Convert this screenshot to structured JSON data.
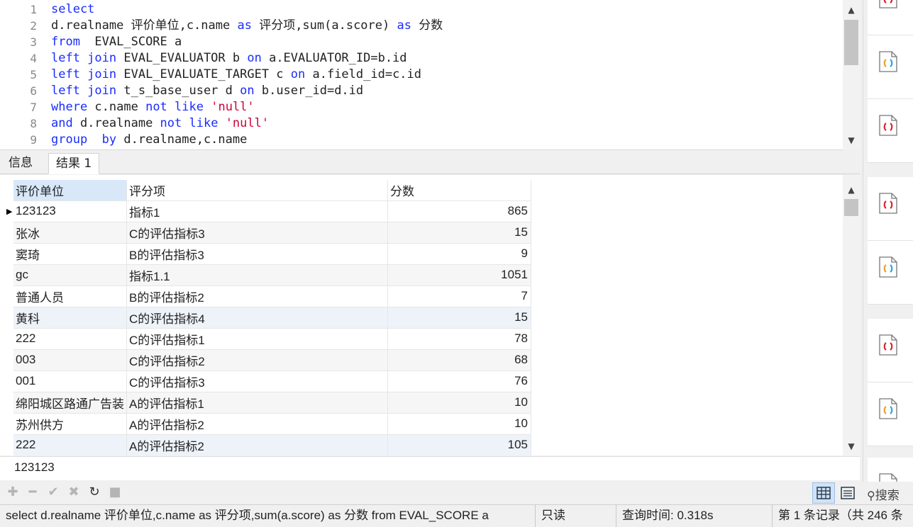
{
  "editor": {
    "lines": [
      {
        "num": "1",
        "tokens": [
          {
            "t": "select",
            "c": "kw"
          }
        ]
      },
      {
        "num": "2",
        "tokens": [
          {
            "t": "d.realname 评价单位,c.name ",
            "c": "id"
          },
          {
            "t": "as",
            "c": "kw"
          },
          {
            "t": " 评分项,sum(a.score) ",
            "c": "id"
          },
          {
            "t": "as",
            "c": "kw"
          },
          {
            "t": " 分数",
            "c": "id"
          }
        ]
      },
      {
        "num": "3",
        "tokens": [
          {
            "t": "from",
            "c": "kw"
          },
          {
            "t": "  EVAL_SCORE a",
            "c": "id"
          }
        ]
      },
      {
        "num": "4",
        "tokens": [
          {
            "t": "left join",
            "c": "kw"
          },
          {
            "t": " EVAL_EVALUATOR b ",
            "c": "id"
          },
          {
            "t": "on",
            "c": "kw"
          },
          {
            "t": " a.EVALUATOR_ID=b.id",
            "c": "id"
          }
        ]
      },
      {
        "num": "5",
        "tokens": [
          {
            "t": "left join",
            "c": "kw"
          },
          {
            "t": " EVAL_EVALUATE_TARGET c ",
            "c": "id"
          },
          {
            "t": "on",
            "c": "kw"
          },
          {
            "t": " a.field_id=c.id",
            "c": "id"
          }
        ]
      },
      {
        "num": "6",
        "tokens": [
          {
            "t": "left join",
            "c": "kw"
          },
          {
            "t": " t_s_base_user d ",
            "c": "id"
          },
          {
            "t": "on",
            "c": "kw"
          },
          {
            "t": " b.user_id=d.id",
            "c": "id"
          }
        ]
      },
      {
        "num": "7",
        "tokens": [
          {
            "t": "where",
            "c": "kw"
          },
          {
            "t": " c.name ",
            "c": "id"
          },
          {
            "t": "not like",
            "c": "kw"
          },
          {
            "t": " ",
            "c": "id"
          },
          {
            "t": "'null'",
            "c": "str"
          }
        ]
      },
      {
        "num": "8",
        "tokens": [
          {
            "t": "and",
            "c": "kw"
          },
          {
            "t": " d.realname ",
            "c": "id"
          },
          {
            "t": "not like",
            "c": "kw"
          },
          {
            "t": " ",
            "c": "id"
          },
          {
            "t": "'null'",
            "c": "str"
          }
        ]
      },
      {
        "num": "9",
        "tokens": [
          {
            "t": "group  by",
            "c": "kw"
          },
          {
            "t": " d.realname,c.name",
            "c": "id"
          }
        ]
      }
    ]
  },
  "tabs": {
    "info": "信息",
    "result": "结果 1"
  },
  "grid": {
    "columns": [
      "评价单位",
      "评分项",
      "分数"
    ],
    "rows": [
      [
        "123123",
        "指标1",
        "865"
      ],
      [
        "张冰",
        "C的评估指标3",
        "15"
      ],
      [
        "窦琦",
        "B的评估指标3",
        "9"
      ],
      [
        "gc",
        "指标1.1",
        "1051"
      ],
      [
        "普通人员",
        "B的评估指标2",
        "7"
      ],
      [
        "黄科",
        "C的评估指标4",
        "15"
      ],
      [
        "222",
        "C的评估指标1",
        "78"
      ],
      [
        "003",
        "C的评估指标2",
        "68"
      ],
      [
        "001",
        "C的评估指标3",
        "76"
      ],
      [
        "绵阳城区路通广告装",
        "A的评估指标1",
        "10"
      ],
      [
        "苏州供方",
        "A的评估指标2",
        "10"
      ],
      [
        "222",
        "A的评估指标2",
        "105"
      ]
    ]
  },
  "selected_value": "123123",
  "toolbar": {
    "search_label": "搜索"
  },
  "status": {
    "sql": "select  d.realname 评价单位,c.name as 评分项,sum(a.score) as 分数 from  EVAL_SCORE a",
    "readonly": "只读",
    "query_time": "查询时间: 0.318s",
    "records": "第 1 条记录（共 246 条"
  },
  "colors": {
    "keyword": "#1a2cff",
    "string": "#d0003a",
    "icon_red": "#d9252c",
    "selected_header": "#d8e8f8"
  }
}
